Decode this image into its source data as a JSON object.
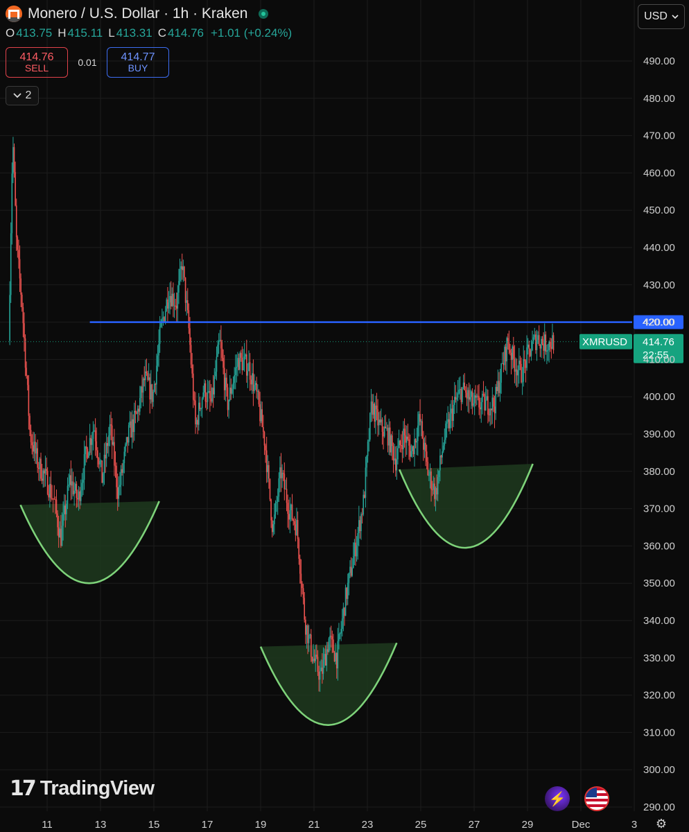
{
  "header": {
    "title": "Monero / U.S. Dollar · 1h · Kraken",
    "ohlc": {
      "o_label": "O",
      "o": "413.75",
      "h_label": "H",
      "h": "415.11",
      "l_label": "L",
      "l": "413.31",
      "c_label": "C",
      "c": "414.76",
      "change": "+1.01 (+0.24%)"
    },
    "sell": {
      "price": "414.76",
      "label": "SELL"
    },
    "spread": "0.01",
    "buy": {
      "price": "414.77",
      "label": "BUY"
    },
    "collapse_count": "2"
  },
  "currency": "USD",
  "branding": {
    "logo_text": "TradingView"
  },
  "colors": {
    "background": "#0b0b0b",
    "up": "#26a69a",
    "down": "#ef5350",
    "resistance_line": "#2962ff",
    "cup_stroke": "#7ed37a",
    "cup_fill": "#1f3a1f",
    "last_price_label": "#16a37f"
  },
  "icons": [
    "monero-icon",
    "live-status-icon",
    "chevron-down-icon",
    "bolt-icon",
    "us-flag-icon",
    "settings-icon"
  ],
  "chart_data": {
    "type": "candlestick",
    "symbol": "XMRUSD",
    "timeframe": "1h",
    "ylim": [
      288,
      503
    ],
    "y_ticks": [
      490,
      480,
      470,
      460,
      450,
      440,
      430,
      420,
      410,
      400,
      390,
      380,
      370,
      360,
      350,
      340,
      330,
      320,
      310,
      300,
      290
    ],
    "x_ticks": [
      {
        "day": 11,
        "label": "11"
      },
      {
        "day": 13,
        "label": "13"
      },
      {
        "day": 15,
        "label": "15"
      },
      {
        "day": 17,
        "label": "17"
      },
      {
        "day": 19,
        "label": "19"
      },
      {
        "day": 21,
        "label": "21"
      },
      {
        "day": 23,
        "label": "23"
      },
      {
        "day": 25,
        "label": "25"
      },
      {
        "day": 27,
        "label": "27"
      },
      {
        "day": 29,
        "label": "29"
      },
      {
        "day": 31,
        "label": "Dec"
      },
      {
        "day": 33,
        "label": "3"
      }
    ],
    "x_range": [
      9.5,
      33.0
    ],
    "price_path": [
      [
        9.6,
        415
      ],
      [
        9.75,
        470
      ],
      [
        9.9,
        440
      ],
      [
        10.1,
        425
      ],
      [
        10.4,
        390
      ],
      [
        10.7,
        382
      ],
      [
        11.0,
        378
      ],
      [
        11.3,
        372
      ],
      [
        11.55,
        362
      ],
      [
        11.9,
        378
      ],
      [
        12.2,
        372
      ],
      [
        12.5,
        385
      ],
      [
        12.8,
        392
      ],
      [
        13.1,
        378
      ],
      [
        13.4,
        392
      ],
      [
        13.7,
        374
      ],
      [
        14.1,
        390
      ],
      [
        14.4,
        395
      ],
      [
        14.7,
        405
      ],
      [
        15.0,
        400
      ],
      [
        15.3,
        418
      ],
      [
        15.6,
        428
      ],
      [
        15.9,
        425
      ],
      [
        16.1,
        436
      ],
      [
        16.35,
        418
      ],
      [
        16.6,
        392
      ],
      [
        16.9,
        402
      ],
      [
        17.2,
        398
      ],
      [
        17.5,
        415
      ],
      [
        17.8,
        398
      ],
      [
        18.2,
        410
      ],
      [
        18.6,
        408
      ],
      [
        18.9,
        400
      ],
      [
        19.2,
        388
      ],
      [
        19.5,
        364
      ],
      [
        19.8,
        380
      ],
      [
        20.1,
        370
      ],
      [
        20.4,
        365
      ],
      [
        20.7,
        340
      ],
      [
        21.0,
        330
      ],
      [
        21.3,
        325
      ],
      [
        21.6,
        335
      ],
      [
        21.9,
        330
      ],
      [
        22.2,
        345
      ],
      [
        22.6,
        360
      ],
      [
        22.9,
        372
      ],
      [
        23.2,
        398
      ],
      [
        23.5,
        392
      ],
      [
        23.8,
        390
      ],
      [
        24.1,
        383
      ],
      [
        24.4,
        390
      ],
      [
        24.7,
        385
      ],
      [
        25.0,
        394
      ],
      [
        25.3,
        380
      ],
      [
        25.6,
        374
      ],
      [
        25.9,
        388
      ],
      [
        26.3,
        398
      ],
      [
        26.6,
        402
      ],
      [
        27.0,
        398
      ],
      [
        27.4,
        398
      ],
      [
        27.8,
        398
      ],
      [
        28.1,
        408
      ],
      [
        28.3,
        415
      ],
      [
        28.5,
        410
      ],
      [
        28.8,
        406
      ],
      [
        29.1,
        412
      ],
      [
        29.4,
        416
      ],
      [
        29.7,
        414
      ],
      [
        30.0,
        414.8
      ]
    ],
    "resistance_line": {
      "price": 420.0,
      "from_day": 12.6,
      "label": "420.00"
    },
    "last_price": {
      "price": 414.76,
      "symbol_label": "XMRUSD",
      "value_label": "414.76",
      "countdown": "22:55"
    },
    "cups": [
      {
        "name": "left-cup",
        "x_start": 10.0,
        "x_end": 15.2,
        "rim_start": 371,
        "rim_end": 372,
        "bottom": 350
      },
      {
        "name": "middle-cup",
        "x_start": 19.0,
        "x_end": 24.1,
        "rim_start": 333,
        "rim_end": 334,
        "bottom": 312
      },
      {
        "name": "right-cup",
        "x_start": 24.2,
        "x_end": 29.2,
        "rim_start": 380.5,
        "rim_end": 382,
        "bottom": 359.5
      }
    ]
  }
}
